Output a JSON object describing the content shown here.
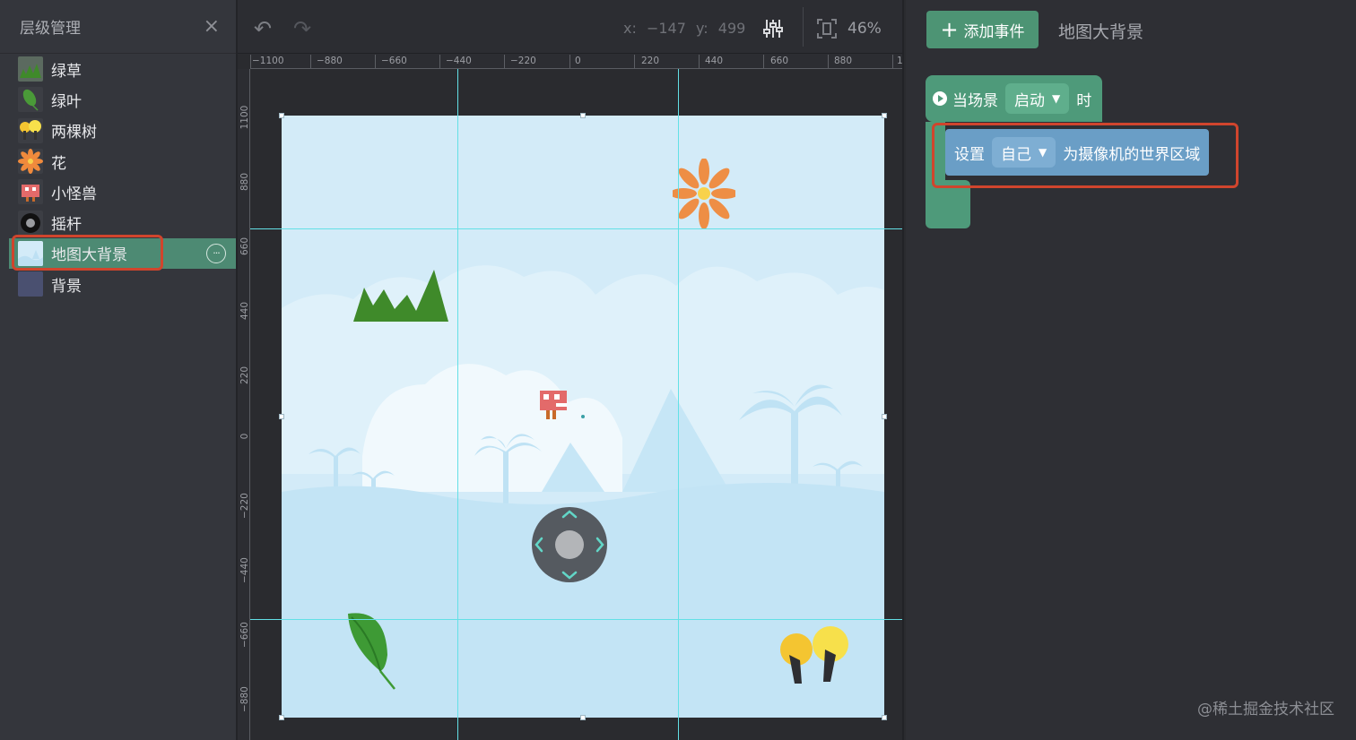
{
  "layer_panel": {
    "title": "层级管理",
    "close_icon": "×",
    "items": [
      {
        "label": "绿草",
        "icon": "grass-thumb"
      },
      {
        "label": "绿叶",
        "icon": "leaf-thumb"
      },
      {
        "label": "两棵树",
        "icon": "trees-thumb"
      },
      {
        "label": "花",
        "icon": "flower-thumb"
      },
      {
        "label": "小怪兽",
        "icon": "monster-thumb"
      },
      {
        "label": "摇杆",
        "icon": "joystick-thumb"
      },
      {
        "label": "地图大背景",
        "icon": "map-bg-thumb",
        "selected": true
      },
      {
        "label": "背景",
        "icon": "bg-thumb"
      }
    ],
    "more_icon": "···"
  },
  "toolbar": {
    "undo_icon": "↶",
    "redo_icon": "↷",
    "coords": "x: −147   y: 499",
    "settings_icon": "sliders",
    "fit_icon": "fit-screen",
    "zoom": "46%"
  },
  "rulers": {
    "h_labels": [
      "−1100",
      "−880",
      "−660",
      "−440",
      "−220",
      "0",
      "220",
      "440",
      "660",
      "880",
      "1"
    ],
    "v_labels": [
      "1100",
      "880",
      "660",
      "440",
      "220",
      "0",
      "−220",
      "−440",
      "−660",
      "−880"
    ]
  },
  "blocks_panel": {
    "add_event_label": "添加事件",
    "add_icon": "+",
    "sprite_name": "地图大背景",
    "hat_block": {
      "prefix": "当场景",
      "dropdown": "启动",
      "suffix": "时"
    },
    "command_block": {
      "prefix": "设置",
      "dropdown": "自己",
      "suffix": "为摄像机的世界区域"
    },
    "caret": "▼"
  },
  "watermark": "@稀土掘金技术社区",
  "colors": {
    "accent_green": "#4d9474",
    "block_green": "#4e9a7a",
    "block_blue": "#6a9ec6",
    "highlight_red": "#d0452d",
    "guide_cyan": "#63e0e6",
    "stage_sky": "#d3ebf8"
  }
}
